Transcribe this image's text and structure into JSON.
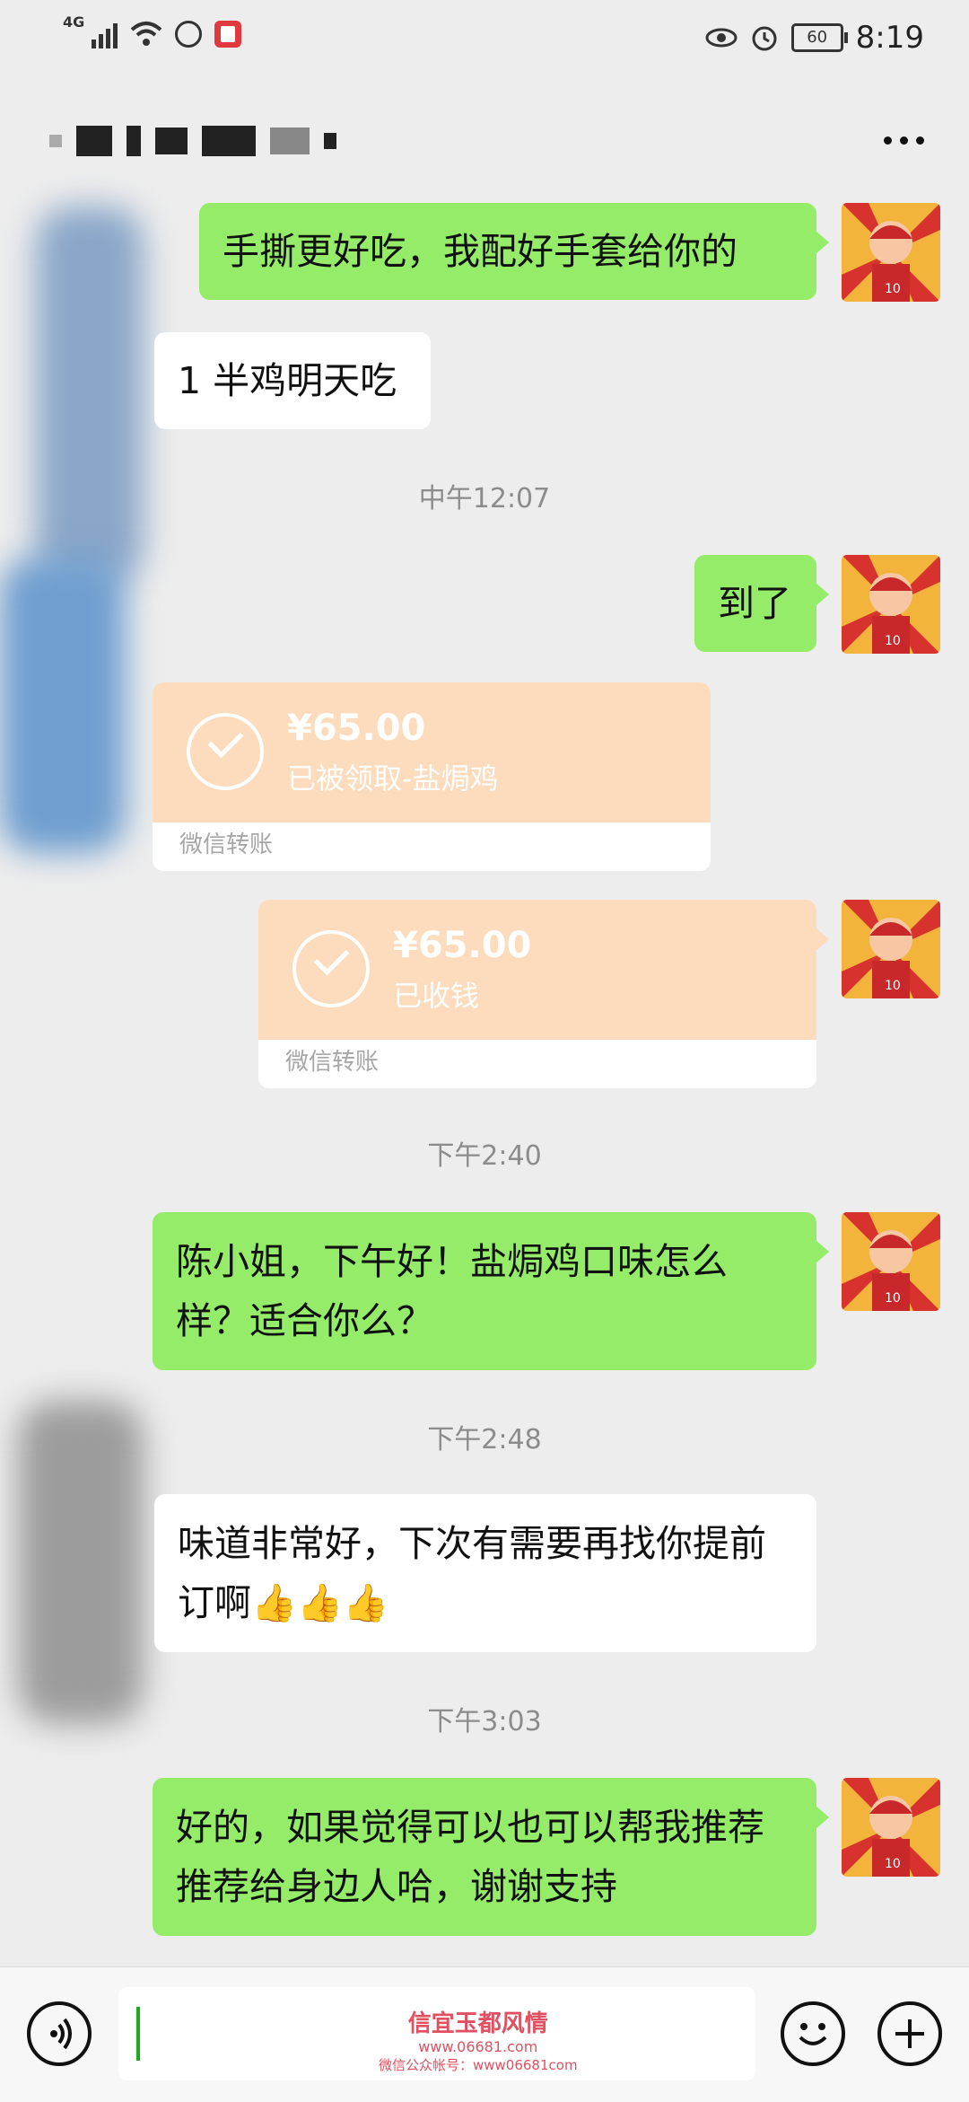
{
  "status_bar": {
    "network": "4G",
    "battery": "60",
    "time": "8:19"
  },
  "header": {
    "more_icon": "more-dots-icon"
  },
  "messages": {
    "m1": "手撕更好吃，我配好手套给你的",
    "m2": "1 半鸡明天吃",
    "t1": "中午12:07",
    "m3": "到了",
    "transfer1": {
      "amount": "¥65.00",
      "status": "已被领取-盐焗鸡",
      "footer": "微信转账"
    },
    "transfer2": {
      "amount": "¥65.00",
      "status": "已收钱",
      "footer": "微信转账"
    },
    "t2": "下午2:40",
    "m4": "陈小姐，下午好！盐焗鸡口味怎么样？适合你么？",
    "t3": "下午2:48",
    "m5": "味道非常好，下次有需要再找你提前订啊👍👍👍",
    "t4": "下午3:03",
    "m6": "好的，如果觉得可以也可以帮我推荐推荐给身边人哈，谢谢支持"
  },
  "input_bar": {
    "voice_icon": "voice-icon",
    "emoji_icon": "emoji-icon",
    "plus_icon": "plus-icon",
    "watermark_title": "信宜玉都风情",
    "watermark_url": "www.06681.com",
    "watermark_sub": "微信公众帐号：www06681com"
  },
  "colors": {
    "bg": "#ededed",
    "green_bubble": "#95ec69",
    "transfer": "#fcdcbd"
  }
}
